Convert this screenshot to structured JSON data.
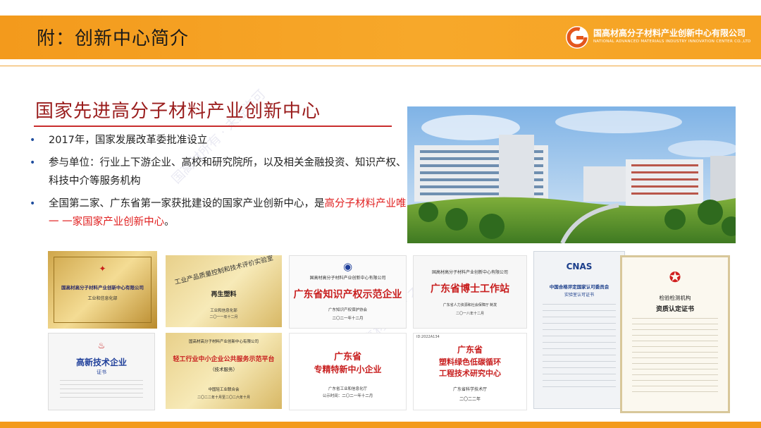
{
  "header": {
    "title": "附：创新中心简介",
    "logo_cn": "国高材高分子材料产业创新中心有限公司",
    "logo_en": "NATIONAL ADVANCED MATERIALS INDUSTRY INNOVATION CENTER CO.,LTD",
    "logo_icon": "g-circle-logo-icon"
  },
  "main": {
    "title": "国家先进高分子材料产业创新中心",
    "bullets": [
      {
        "text": "2017年，国家发展改革委批准设立"
      },
      {
        "text": "参与单位：行业上下游企业、高校和研究院所，以及相关金融投资、知识产权、科技中介等服务机构"
      },
      {
        "text_before": "全国第二家、广东省第一家获批建设的国家产业创新中心，是",
        "highlight": "高分子材料产业唯一 一家国家产业创新中心",
        "text_after": "。"
      }
    ]
  },
  "certificates": {
    "c1": {
      "line1": "国高材高分子材料产业创新中心有限公司",
      "line2": "工业和信息化部"
    },
    "c2": {
      "arc": "工业产品质量控制和技术评价实验室",
      "name": "再生塑料",
      "issuer": "工业和信息化部",
      "date": "二〇一一年十二月"
    },
    "c3": {
      "org": "国高材高分子材料产业创新中心有限公司",
      "title": "广东省知识产权示范企业",
      "issuer": "广东知识产权保护协会",
      "date": "二〇二一年十二月"
    },
    "c4": {
      "org": "国高材高分子材料产业创新中心有限公司",
      "title": "广东省博士工作站",
      "issuer": "广东省人力资源和社会保障厅 制发",
      "date": "二〇一八年十二月"
    },
    "c5": {
      "line1": "中国合格评定国家认可委员会",
      "line2": "实验室认可证书",
      "brand": "CNAS"
    },
    "c6": {
      "line1": "检验检测机构",
      "line2": "资质认定证书"
    },
    "c7": {
      "title": "高新技术企业",
      "sub": "证书"
    },
    "c8": {
      "org": "国高材高分子材料产业创新中心有限公司",
      "title": "轻工行业中小企业公共服务示范平台",
      "sub": "（技术服务）",
      "issuer": "中国轻工业联合会",
      "date": "二〇二二年十月至二〇二六年十月"
    },
    "c9": {
      "line1": "广东省",
      "line2": "专精特新中小企业",
      "issuer": "广东省工业和信息化厅",
      "date": "公示时间：二〇二一年十二月"
    },
    "c10": {
      "id": "ID:2022A134",
      "line1": "广东省",
      "line2": "塑料绿色低碳循环",
      "line3": "工程技术研究中心",
      "issuer": "广东省科学技术厅",
      "date": "二〇二二年"
    }
  },
  "colors": {
    "accent": "#f39a1c",
    "title_red": "#9a1d1d",
    "highlight": "#e02020",
    "bullet": "#1f4e9e"
  }
}
